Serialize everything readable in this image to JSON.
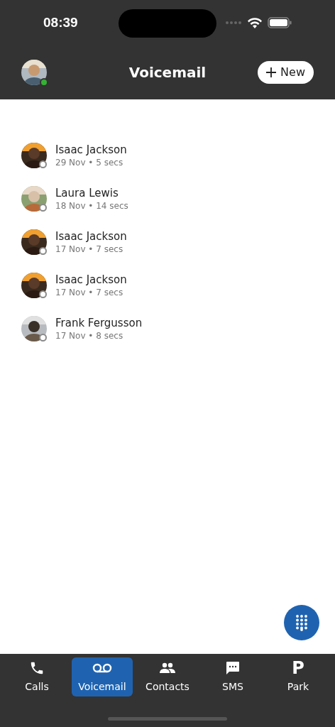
{
  "status_bar": {
    "time": "08:39"
  },
  "header": {
    "title": "Voicemail",
    "online": true,
    "new_button": {
      "label": "New"
    }
  },
  "voicemails": [
    {
      "name": "Isaac Jackson",
      "detail": "29 Nov • 5 secs",
      "online": false
    },
    {
      "name": "Laura Lewis",
      "detail": "18 Nov • 14 secs",
      "online": false
    },
    {
      "name": "Isaac Jackson",
      "detail": "17 Nov • 7 secs",
      "online": false
    },
    {
      "name": "Isaac Jackson",
      "detail": "17 Nov • 7 secs",
      "online": false
    },
    {
      "name": "Frank Fergusson",
      "detail": "17 Nov • 8 secs",
      "online": false
    }
  ],
  "tabs": [
    {
      "label": "Calls",
      "kind": "phone",
      "selected": false
    },
    {
      "label": "Voicemail",
      "kind": "voicemail",
      "selected": true
    },
    {
      "label": "Contacts",
      "kind": "people",
      "selected": false
    },
    {
      "label": "SMS",
      "kind": "message",
      "selected": false
    },
    {
      "label": "Park",
      "kind": "glyph",
      "glyph": "P",
      "selected": false
    }
  ]
}
